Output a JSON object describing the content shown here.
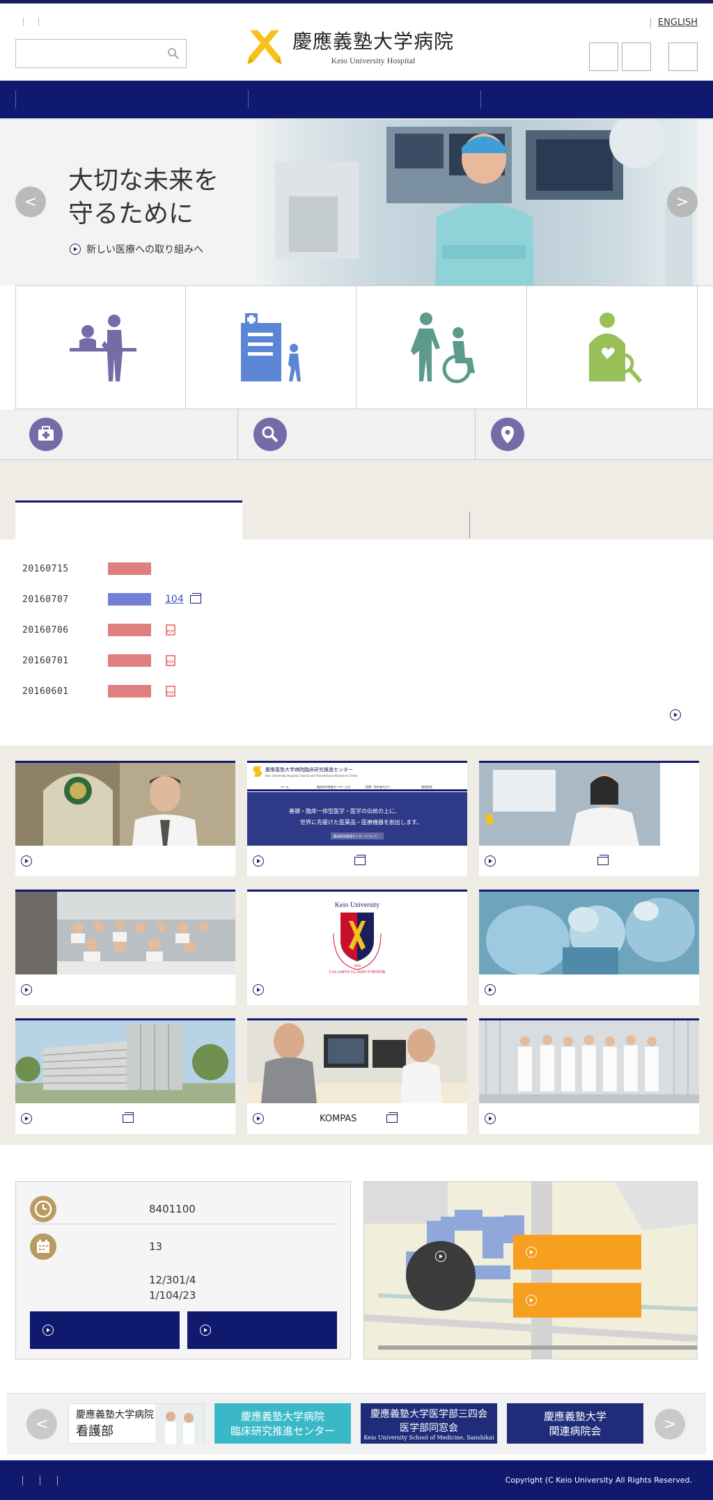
{
  "header": {
    "logo_title": "慶應義塾大学病院",
    "logo_subtitle": "Keio University Hospital",
    "english_link": "ENGLISH",
    "search_placeholder": ""
  },
  "hero": {
    "catch_line1": "大切な未来を",
    "catch_line2": "守るために",
    "link_text": "新しい医療への取り組みへ",
    "prev": "<",
    "next": ">"
  },
  "news": {
    "items": [
      {
        "date": "20160715",
        "cat_color": "#e07f7f",
        "title": "",
        "icon": "underline"
      },
      {
        "date": "20160707",
        "cat_color": "#727fd6",
        "title": "104",
        "icon": "window"
      },
      {
        "date": "20160706",
        "cat_color": "#e07f7f",
        "title": "",
        "icon": "pdf"
      },
      {
        "date": "20160701",
        "cat_color": "#e07f7f",
        "title": "",
        "icon": "pdf"
      },
      {
        "date": "20160601",
        "cat_color": "#e07f7f",
        "title": "",
        "icon": "pdf"
      }
    ]
  },
  "banners": [
    {
      "label": "",
      "external": false,
      "image": "doctor-portrait"
    },
    {
      "label": "",
      "external": true,
      "image": "clinical-research-center-site"
    },
    {
      "label": "",
      "external": true,
      "image": "lab-researchers"
    },
    {
      "label": "",
      "external": false,
      "image": "lecture-room"
    },
    {
      "label": "",
      "external": false,
      "image": "keio-crest"
    },
    {
      "label": "",
      "external": false,
      "image": "surgery"
    },
    {
      "label": "",
      "external": true,
      "image": "hospital-building"
    },
    {
      "label": "KOMPAS",
      "external": true,
      "image": "doctor-monitor"
    },
    {
      "label": "",
      "external": false,
      "image": "staff-group"
    }
  ],
  "banner_site": {
    "title": "慶應義塾大学病院臨床研究推進センター",
    "subtitle": "Keio University Hospital Clinical and Translational Research Center",
    "nav1": "ホーム",
    "nav2": "臨床研究推進センターとは",
    "nav3": "医療・研究者の方へ",
    "nav4": "報道発表",
    "catch1": "基礎・臨床一体型医学・医学の伝統の上に、",
    "catch2": "世界に先駆けた医薬品・医療機器を創出します。",
    "button": "臨床研究推進センターについて"
  },
  "banner_crest": {
    "name": "Keio University",
    "year": "1858",
    "motto": "CALAMVS GLADIO FORTIOR"
  },
  "info": {
    "hours": "8401100",
    "closed": "13",
    "holiday1": "12/301/4",
    "holiday2": "1/104/23"
  },
  "related": [
    {
      "line1": "慶應義塾大学病院",
      "line2": "看護部",
      "line3": ""
    },
    {
      "line1": "慶應義塾大学病院",
      "line2": "臨床研究推進センター",
      "line3": ""
    },
    {
      "line1": "慶應義塾大学医学部三四会",
      "line2": "医学部同窓会",
      "line3": "Keio University School of Medicine, Sanshikai"
    },
    {
      "line1": "慶應義塾大学",
      "line2": "関連病院会",
      "line3": ""
    }
  ],
  "related_nav": {
    "prev": "<",
    "next": ">"
  },
  "footer": {
    "copyright": "Copyright (C Keio University All Rights Reserved."
  },
  "colors": {
    "navy": "#0f1a6e",
    "gold": "#f5c11b",
    "orange": "#f7a01f",
    "beige": "#eeece5",
    "purple": "#736ca6"
  }
}
